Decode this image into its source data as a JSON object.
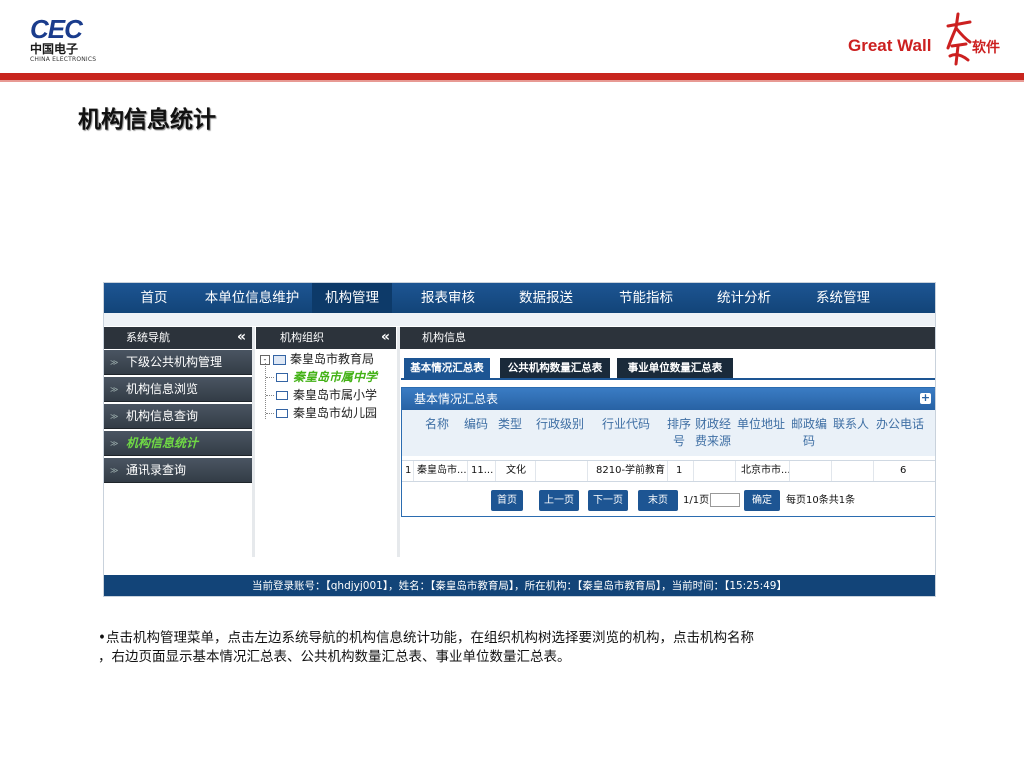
{
  "logos": {
    "cec": {
      "big": "CEC",
      "cn": "中国电子",
      "en": "CHINA ELECTRONICS"
    },
    "greatwall": {
      "text": "Great Wall",
      "mark": "长城",
      "soft": "软件"
    }
  },
  "slide_title": "机构信息统计",
  "menubar": {
    "items": [
      "首页",
      "本单位信息维护",
      "机构管理",
      "报表审核",
      "数据报送",
      "节能指标",
      "统计分析",
      "系统管理"
    ],
    "active": "机构管理"
  },
  "sidebar": {
    "title": "系统导航",
    "collapse": "«",
    "items": [
      "下级公共机构管理",
      "机构信息浏览",
      "机构信息查询",
      "机构信息统计",
      "通讯录查询"
    ]
  },
  "tree": {
    "title": "机构组织",
    "collapse": "«",
    "expander": "-",
    "root": "秦皇岛市教育局",
    "children": [
      "秦皇岛市属中学",
      "秦皇岛市属小学",
      "秦皇岛市幼儿园"
    ]
  },
  "info": {
    "title": "机构信息",
    "tabs": [
      "基本情况汇总表",
      "公共机构数量汇总表",
      "事业单位数量汇总表"
    ],
    "panel_title": "基本情况汇总表",
    "panel_plus": "+",
    "columns": [
      "名称",
      "编码",
      "类型",
      "行政级别",
      "行业代码",
      "排序号",
      "财政经费来源",
      "单位地址",
      "邮政编码",
      "联系人",
      "办公电话"
    ],
    "column_lines": {
      "sort": [
        "排序",
        "号"
      ],
      "fund": [
        "财政经",
        "费来源"
      ],
      "postal": [
        "邮政编",
        "码"
      ]
    },
    "rows": [
      {
        "index": "1",
        "name": "秦皇岛市...",
        "code": "11...",
        "type": "文化",
        "level": "",
        "industry": "8210-学前教育",
        "sort": "1",
        "fund": "",
        "address": "北京市市...",
        "postal": "",
        "contact": "",
        "phone": "6"
      }
    ],
    "pager": {
      "first": "首页",
      "prev": "上一页",
      "next": "下一页",
      "last": "末页",
      "page_info": "1/1页",
      "input_value": "",
      "confirm": "确定",
      "summary": "每页10条共1条"
    }
  },
  "status": "当前登录账号：【qhdjyj001】，姓名：【秦皇岛市教育局】，所在机构：【秦皇岛市教育局】，当前时间：【15:25:49】",
  "description_lines": [
    "•点击机构管理菜单，点击左边系统导航的机构信息统计功能，在组织机构树选择要浏览的机构，点击机构名称",
    "，右边页面显示基本情况汇总表、公共机构数量汇总表、事业单位数量汇总表。"
  ],
  "colors": {
    "brand_red": "#c8251e",
    "menu_blue": "#1d5593",
    "nav_dark": "#2c333b",
    "active_green": "#43b216",
    "cec_blue": "#1a3c8c"
  }
}
